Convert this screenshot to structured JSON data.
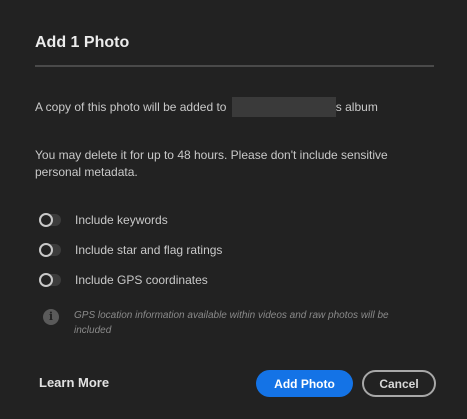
{
  "dialog": {
    "title": "Add 1 Photo",
    "album_prefix": "A copy of this photo will be added to ",
    "album_suffix": "s album",
    "delete_notice": "You may delete it for up to 48 hours. Please don't include sensitive personal metadata.",
    "options": [
      {
        "label": "Include keywords",
        "enabled": false
      },
      {
        "label": "Include star and flag ratings",
        "enabled": false
      },
      {
        "label": "Include GPS coordinates",
        "enabled": false
      }
    ],
    "info_note": "GPS location information available within videos and raw photos will be included",
    "learn_more": "Learn More",
    "add_button": "Add Photo",
    "cancel_button": "Cancel"
  },
  "colors": {
    "background": "#222222",
    "accent": "#1473e6"
  }
}
